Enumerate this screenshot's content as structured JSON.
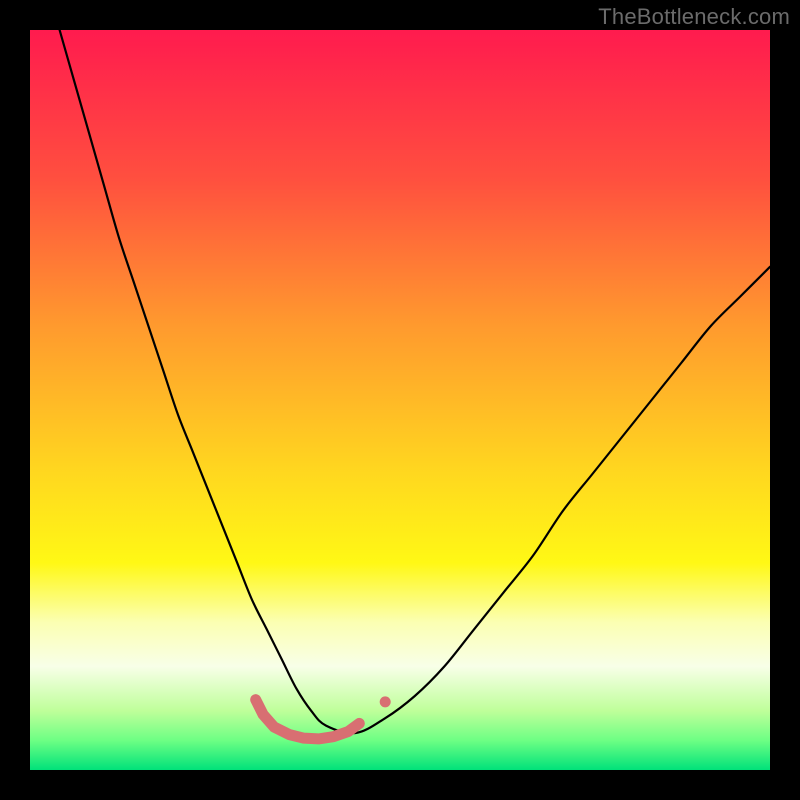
{
  "watermark": "TheBottleneck.com",
  "chart_data": {
    "type": "line",
    "title": "",
    "xlabel": "",
    "ylabel": "",
    "xlim": [
      0,
      100
    ],
    "ylim": [
      0,
      100
    ],
    "grid": false,
    "legend": false,
    "background_gradient": {
      "stops": [
        {
          "offset": 0.0,
          "color": "#ff1b4e"
        },
        {
          "offset": 0.2,
          "color": "#ff4f3f"
        },
        {
          "offset": 0.4,
          "color": "#ff9a2e"
        },
        {
          "offset": 0.6,
          "color": "#ffd81f"
        },
        {
          "offset": 0.72,
          "color": "#fff815"
        },
        {
          "offset": 0.8,
          "color": "#fbffb2"
        },
        {
          "offset": 0.86,
          "color": "#f8ffe8"
        },
        {
          "offset": 0.92,
          "color": "#bfff9a"
        },
        {
          "offset": 0.96,
          "color": "#6dff84"
        },
        {
          "offset": 1.0,
          "color": "#00e27a"
        }
      ]
    },
    "series": [
      {
        "name": "bottleneck-curve",
        "stroke": "#000000",
        "stroke_width": 2.2,
        "x": [
          4,
          6,
          8,
          10,
          12,
          14,
          16,
          18,
          20,
          22,
          24,
          26,
          28,
          30,
          32,
          34,
          36,
          38,
          40,
          44,
          48,
          52,
          56,
          60,
          64,
          68,
          72,
          76,
          80,
          84,
          88,
          92,
          96,
          100
        ],
        "y": [
          100,
          93,
          86,
          79,
          72,
          66,
          60,
          54,
          48,
          43,
          38,
          33,
          28,
          23,
          19,
          15,
          11,
          8,
          6,
          5,
          7,
          10,
          14,
          19,
          24,
          29,
          35,
          40,
          45,
          50,
          55,
          60,
          64,
          68
        ]
      }
    ],
    "markers": {
      "name": "trough-markers",
      "stroke": "#d86f72",
      "stroke_width": 11,
      "stroke_linecap": "round",
      "points_xy": [
        [
          30.5,
          9.5
        ],
        [
          31.5,
          7.5
        ],
        [
          33.0,
          5.8
        ],
        [
          35.0,
          4.8
        ],
        [
          37.0,
          4.3
        ],
        [
          39.0,
          4.2
        ],
        [
          41.0,
          4.5
        ],
        [
          43.0,
          5.2
        ],
        [
          44.5,
          6.3
        ]
      ],
      "detached_point_xy": [
        48.0,
        9.2
      ]
    }
  }
}
